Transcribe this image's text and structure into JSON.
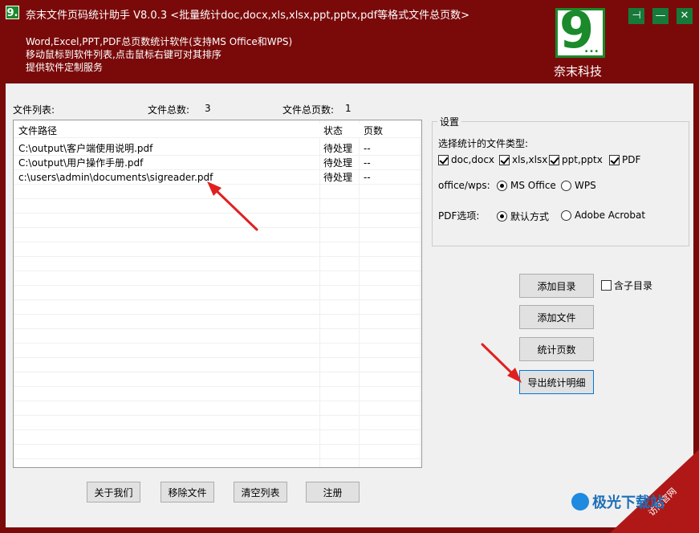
{
  "window": {
    "title": "奈末文件页码统计助手 V8.0.3 <批量统计doc,docx,xls,xlsx,ppt,pptx,pdf等格式文件总页数>",
    "app_icon_text": "9.",
    "desc_lines": [
      "Word,Excel,PPT,PDF总页数统计软件(支持MS Office和WPS)",
      "移动鼠标到软件列表,点击鼠标右键可对其排序",
      "提供软件定制服务"
    ],
    "logo_mark": "9",
    "logo_dots": "...",
    "logo_text": "奈末科技",
    "controls": {
      "pin": "⊣",
      "minimize": "—",
      "close": "✕"
    }
  },
  "summary": {
    "file_list_label": "文件列表:",
    "total_files_label": "文件总数:",
    "total_files_value": "3",
    "total_pages_label": "文件总页数:",
    "total_pages_value": "1"
  },
  "table": {
    "columns": [
      "文件路径",
      "状态",
      "页数"
    ],
    "rows": [
      {
        "path": "C:\\output\\客户端使用说明.pdf",
        "status": "待处理",
        "pages": "--"
      },
      {
        "path": "C:\\output\\用户操作手册.pdf",
        "status": "待处理",
        "pages": "--"
      },
      {
        "path": "c:\\users\\admin\\documents\\sigreader.pdf",
        "status": "待处理",
        "pages": "--"
      }
    ]
  },
  "settings": {
    "group_title": "设置",
    "types_label": "选择统计的文件类型:",
    "types": [
      {
        "label": "doc,docx",
        "checked": true
      },
      {
        "label": "xls,xlsx",
        "checked": true
      },
      {
        "label": "ppt,pptx",
        "checked": true
      },
      {
        "label": "PDF",
        "checked": true
      }
    ],
    "office_label": "office/wps:",
    "office_options": [
      {
        "label": "MS Office",
        "selected": true
      },
      {
        "label": "WPS",
        "selected": false
      }
    ],
    "pdf_label": "PDF选项:",
    "pdf_options": [
      {
        "label": "默认方式",
        "selected": true
      },
      {
        "label": "Adobe Acrobat",
        "selected": false
      }
    ]
  },
  "actions": {
    "add_dir": "添加目录",
    "include_subdir": "含子目录",
    "include_subdir_checked": false,
    "add_file": "添加文件",
    "count_pages": "统计页数",
    "export_details": "导出统计明细"
  },
  "footer": {
    "about": "关于我们",
    "remove": "移除文件",
    "clear": "清空列表",
    "register": "注册"
  },
  "watermark": {
    "corner_text": "访问官网",
    "brand": "极光下载站"
  },
  "colors": {
    "titlebar": "#7a0a0a",
    "accent_green": "#1a8a2a",
    "arrow_red": "#e02020"
  }
}
